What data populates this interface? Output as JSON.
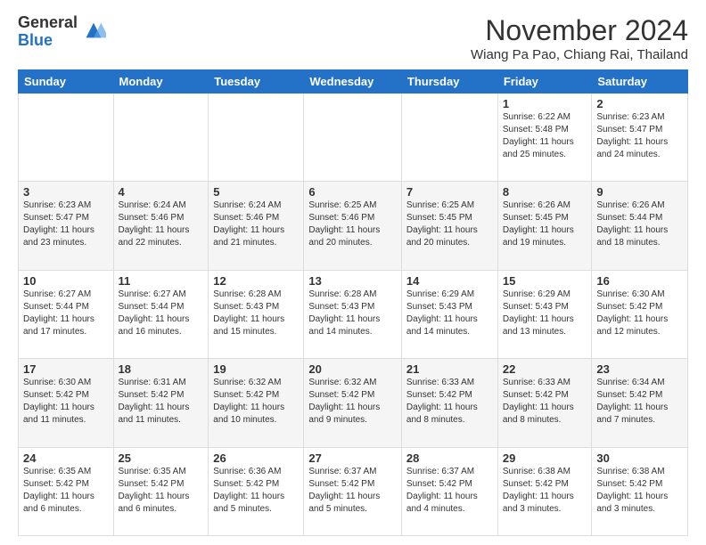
{
  "logo": {
    "general": "General",
    "blue": "Blue"
  },
  "title": "November 2024",
  "location": "Wiang Pa Pao, Chiang Rai, Thailand",
  "days_of_week": [
    "Sunday",
    "Monday",
    "Tuesday",
    "Wednesday",
    "Thursday",
    "Friday",
    "Saturday"
  ],
  "weeks": [
    [
      {
        "day": "",
        "info": ""
      },
      {
        "day": "",
        "info": ""
      },
      {
        "day": "",
        "info": ""
      },
      {
        "day": "",
        "info": ""
      },
      {
        "day": "",
        "info": ""
      },
      {
        "day": "1",
        "info": "Sunrise: 6:22 AM\nSunset: 5:48 PM\nDaylight: 11 hours and 25 minutes."
      },
      {
        "day": "2",
        "info": "Sunrise: 6:23 AM\nSunset: 5:47 PM\nDaylight: 11 hours and 24 minutes."
      }
    ],
    [
      {
        "day": "3",
        "info": "Sunrise: 6:23 AM\nSunset: 5:47 PM\nDaylight: 11 hours and 23 minutes."
      },
      {
        "day": "4",
        "info": "Sunrise: 6:24 AM\nSunset: 5:46 PM\nDaylight: 11 hours and 22 minutes."
      },
      {
        "day": "5",
        "info": "Sunrise: 6:24 AM\nSunset: 5:46 PM\nDaylight: 11 hours and 21 minutes."
      },
      {
        "day": "6",
        "info": "Sunrise: 6:25 AM\nSunset: 5:46 PM\nDaylight: 11 hours and 20 minutes."
      },
      {
        "day": "7",
        "info": "Sunrise: 6:25 AM\nSunset: 5:45 PM\nDaylight: 11 hours and 20 minutes."
      },
      {
        "day": "8",
        "info": "Sunrise: 6:26 AM\nSunset: 5:45 PM\nDaylight: 11 hours and 19 minutes."
      },
      {
        "day": "9",
        "info": "Sunrise: 6:26 AM\nSunset: 5:44 PM\nDaylight: 11 hours and 18 minutes."
      }
    ],
    [
      {
        "day": "10",
        "info": "Sunrise: 6:27 AM\nSunset: 5:44 PM\nDaylight: 11 hours and 17 minutes."
      },
      {
        "day": "11",
        "info": "Sunrise: 6:27 AM\nSunset: 5:44 PM\nDaylight: 11 hours and 16 minutes."
      },
      {
        "day": "12",
        "info": "Sunrise: 6:28 AM\nSunset: 5:43 PM\nDaylight: 11 hours and 15 minutes."
      },
      {
        "day": "13",
        "info": "Sunrise: 6:28 AM\nSunset: 5:43 PM\nDaylight: 11 hours and 14 minutes."
      },
      {
        "day": "14",
        "info": "Sunrise: 6:29 AM\nSunset: 5:43 PM\nDaylight: 11 hours and 14 minutes."
      },
      {
        "day": "15",
        "info": "Sunrise: 6:29 AM\nSunset: 5:43 PM\nDaylight: 11 hours and 13 minutes."
      },
      {
        "day": "16",
        "info": "Sunrise: 6:30 AM\nSunset: 5:42 PM\nDaylight: 11 hours and 12 minutes."
      }
    ],
    [
      {
        "day": "17",
        "info": "Sunrise: 6:30 AM\nSunset: 5:42 PM\nDaylight: 11 hours and 11 minutes."
      },
      {
        "day": "18",
        "info": "Sunrise: 6:31 AM\nSunset: 5:42 PM\nDaylight: 11 hours and 11 minutes."
      },
      {
        "day": "19",
        "info": "Sunrise: 6:32 AM\nSunset: 5:42 PM\nDaylight: 11 hours and 10 minutes."
      },
      {
        "day": "20",
        "info": "Sunrise: 6:32 AM\nSunset: 5:42 PM\nDaylight: 11 hours and 9 minutes."
      },
      {
        "day": "21",
        "info": "Sunrise: 6:33 AM\nSunset: 5:42 PM\nDaylight: 11 hours and 8 minutes."
      },
      {
        "day": "22",
        "info": "Sunrise: 6:33 AM\nSunset: 5:42 PM\nDaylight: 11 hours and 8 minutes."
      },
      {
        "day": "23",
        "info": "Sunrise: 6:34 AM\nSunset: 5:42 PM\nDaylight: 11 hours and 7 minutes."
      }
    ],
    [
      {
        "day": "24",
        "info": "Sunrise: 6:35 AM\nSunset: 5:42 PM\nDaylight: 11 hours and 6 minutes."
      },
      {
        "day": "25",
        "info": "Sunrise: 6:35 AM\nSunset: 5:42 PM\nDaylight: 11 hours and 6 minutes."
      },
      {
        "day": "26",
        "info": "Sunrise: 6:36 AM\nSunset: 5:42 PM\nDaylight: 11 hours and 5 minutes."
      },
      {
        "day": "27",
        "info": "Sunrise: 6:37 AM\nSunset: 5:42 PM\nDaylight: 11 hours and 5 minutes."
      },
      {
        "day": "28",
        "info": "Sunrise: 6:37 AM\nSunset: 5:42 PM\nDaylight: 11 hours and 4 minutes."
      },
      {
        "day": "29",
        "info": "Sunrise: 6:38 AM\nSunset: 5:42 PM\nDaylight: 11 hours and 3 minutes."
      },
      {
        "day": "30",
        "info": "Sunrise: 6:38 AM\nSunset: 5:42 PM\nDaylight: 11 hours and 3 minutes."
      }
    ]
  ]
}
